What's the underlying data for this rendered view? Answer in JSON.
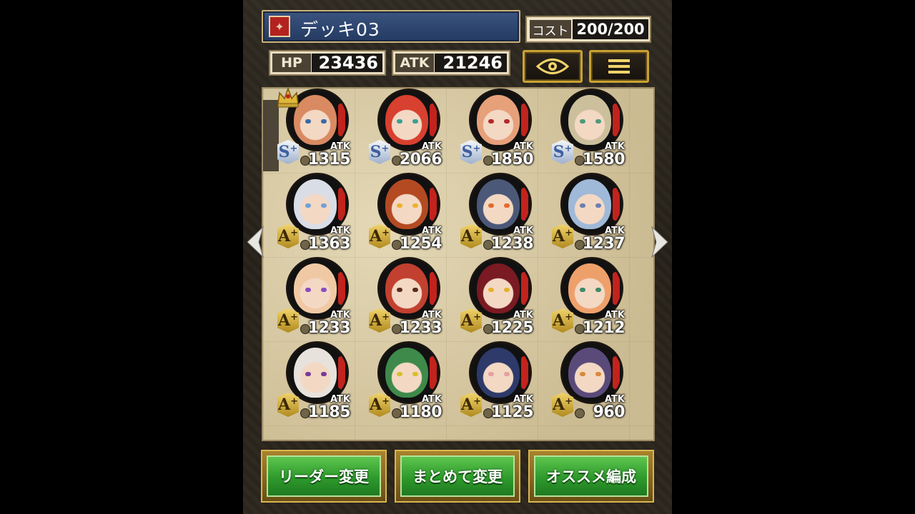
{
  "header": {
    "deck_title": "デッキ03",
    "cost_label": "コスト",
    "cost_value": "200/200",
    "hp_label": "HP",
    "hp_value": "23436",
    "atk_label": "ATK",
    "atk_value": "21246",
    "view_icon": "eye-icon",
    "menu_icon": "list-icon"
  },
  "cards": [
    {
      "rank": "S",
      "atk": "1315",
      "leader": true,
      "hair": "#d98a62",
      "eye": "#3b6aa6"
    },
    {
      "rank": "S",
      "atk": "2066",
      "hair": "#d8402f",
      "eye": "#3aa093"
    },
    {
      "rank": "S",
      "atk": "1850",
      "hair": "#e6a07a",
      "eye": "#b32a2a"
    },
    {
      "rank": "S",
      "atk": "1580",
      "hair": "#cbbf9c",
      "eye": "#4d9a7a"
    },
    {
      "rank": "A",
      "atk": "1363",
      "hair": "#d9dde6",
      "eye": "#6fa2d8"
    },
    {
      "rank": "A",
      "atk": "1254",
      "hair": "#b34a22",
      "eye": "#f0b02a"
    },
    {
      "rank": "A",
      "atk": "1238",
      "hair": "#4b5878",
      "eye": "#e46a2a"
    },
    {
      "rank": "A",
      "atk": "1237",
      "hair": "#9fb9d8",
      "eye": "#6a7fb0"
    },
    {
      "rank": "A",
      "atk": "1233",
      "hair": "#f0c9a4",
      "eye": "#8b4bc0"
    },
    {
      "rank": "A",
      "atk": "1233",
      "hair": "#c2402f",
      "eye": "#5a2a20"
    },
    {
      "rank": "A",
      "atk": "1225",
      "hair": "#7a1a22",
      "eye": "#e6b02a"
    },
    {
      "rank": "A",
      "atk": "1212",
      "hair": "#eea06a",
      "eye": "#3e8a6a"
    },
    {
      "rank": "A",
      "atk": "1185",
      "hair": "#e8e2dc",
      "eye": "#7a3a9a"
    },
    {
      "rank": "A",
      "atk": "1180",
      "hair": "#3e8a4a",
      "eye": "#d8c02a"
    },
    {
      "rank": "A",
      "atk": "1125",
      "hair": "#2d3a6a",
      "eye": "#e6a0a0"
    },
    {
      "rank": "A",
      "atk": "960",
      "hair": "#5a4a7a",
      "eye": "#d88a3a"
    }
  ],
  "atk_small_label": "ATK",
  "colors": {
    "leader_crown": "#c9a233",
    "button_green": "#2e9a2c",
    "deck_blue": "#2c4470"
  },
  "buttons": {
    "change_leader": "リーダー変更",
    "batch_change": "まとめて変更",
    "recommended": "オススメ編成"
  }
}
